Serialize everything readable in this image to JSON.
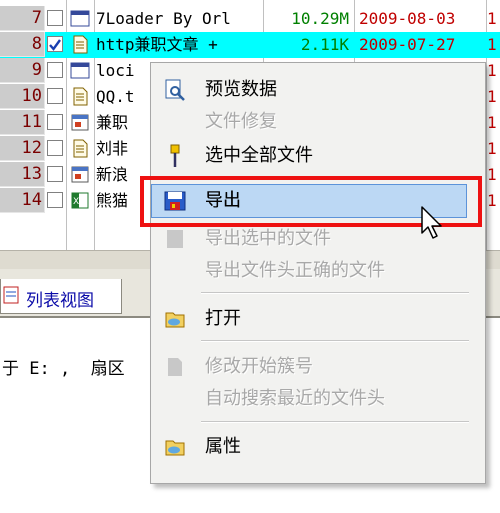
{
  "table": {
    "rows": [
      {
        "num": "7",
        "name": "7Loader By Orl",
        "size": "10.29M",
        "date": "2009-08-03",
        "extra": "1",
        "checked": false,
        "icon": "window-icon",
        "selected": false
      },
      {
        "num": "8",
        "name": "http兼职文章 +",
        "size": "2.11K",
        "date": "2009-07-27",
        "extra": "1",
        "checked": true,
        "icon": "document-icon",
        "selected": true
      },
      {
        "num": "9",
        "name": "loci",
        "size": "",
        "date": "",
        "extra": "1",
        "checked": false,
        "icon": "window-icon",
        "selected": false
      },
      {
        "num": "10",
        "name": "QQ.t",
        "size": "",
        "date": "",
        "extra": "1",
        "checked": false,
        "icon": "document-icon",
        "selected": false
      },
      {
        "num": "11",
        "name": "兼职",
        "size": "",
        "date": "",
        "extra": "1",
        "checked": false,
        "icon": "webpage-icon",
        "selected": false
      },
      {
        "num": "12",
        "name": "刘非",
        "size": "",
        "date": "",
        "extra": "1",
        "checked": false,
        "icon": "document-icon",
        "selected": false
      },
      {
        "num": "13",
        "name": "新浪",
        "size": "",
        "date": "",
        "extra": "1",
        "checked": false,
        "icon": "webpage-icon",
        "selected": false
      },
      {
        "num": "14",
        "name": "熊猫",
        "size": "",
        "date": "",
        "extra": "1",
        "checked": false,
        "icon": "spreadsheet-icon",
        "selected": false
      }
    ]
  },
  "tabs": {
    "list_view_label": "列表视图"
  },
  "status": {
    "text": "于 E: ,  扇区"
  },
  "context_menu": {
    "items": [
      {
        "label": "预览数据",
        "enabled": true,
        "icon": "preview-icon"
      },
      {
        "label": "文件修复",
        "enabled": false,
        "icon": ""
      },
      {
        "label": "选中全部文件",
        "enabled": true,
        "icon": "pin-icon"
      },
      {
        "label": "导出",
        "enabled": true,
        "icon": "export-icon",
        "hovered": true
      },
      {
        "label": "导出选中的文件",
        "enabled": false,
        "icon": "export-selected-icon"
      },
      {
        "label": "导出文件头正确的文件",
        "enabled": false,
        "icon": ""
      },
      {
        "label": "打开",
        "enabled": true,
        "icon": "open-icon"
      },
      {
        "label": "修改开始簇号",
        "enabled": false,
        "icon": "edit-cluster-icon"
      },
      {
        "label": "自动搜索最近的文件头",
        "enabled": false,
        "icon": ""
      },
      {
        "label": "属性",
        "enabled": true,
        "icon": "properties-icon"
      }
    ]
  },
  "colors": {
    "selected_row": "#00ffff",
    "highlight_box": "#ee1111",
    "menu_hover": "#bcd8f4"
  }
}
